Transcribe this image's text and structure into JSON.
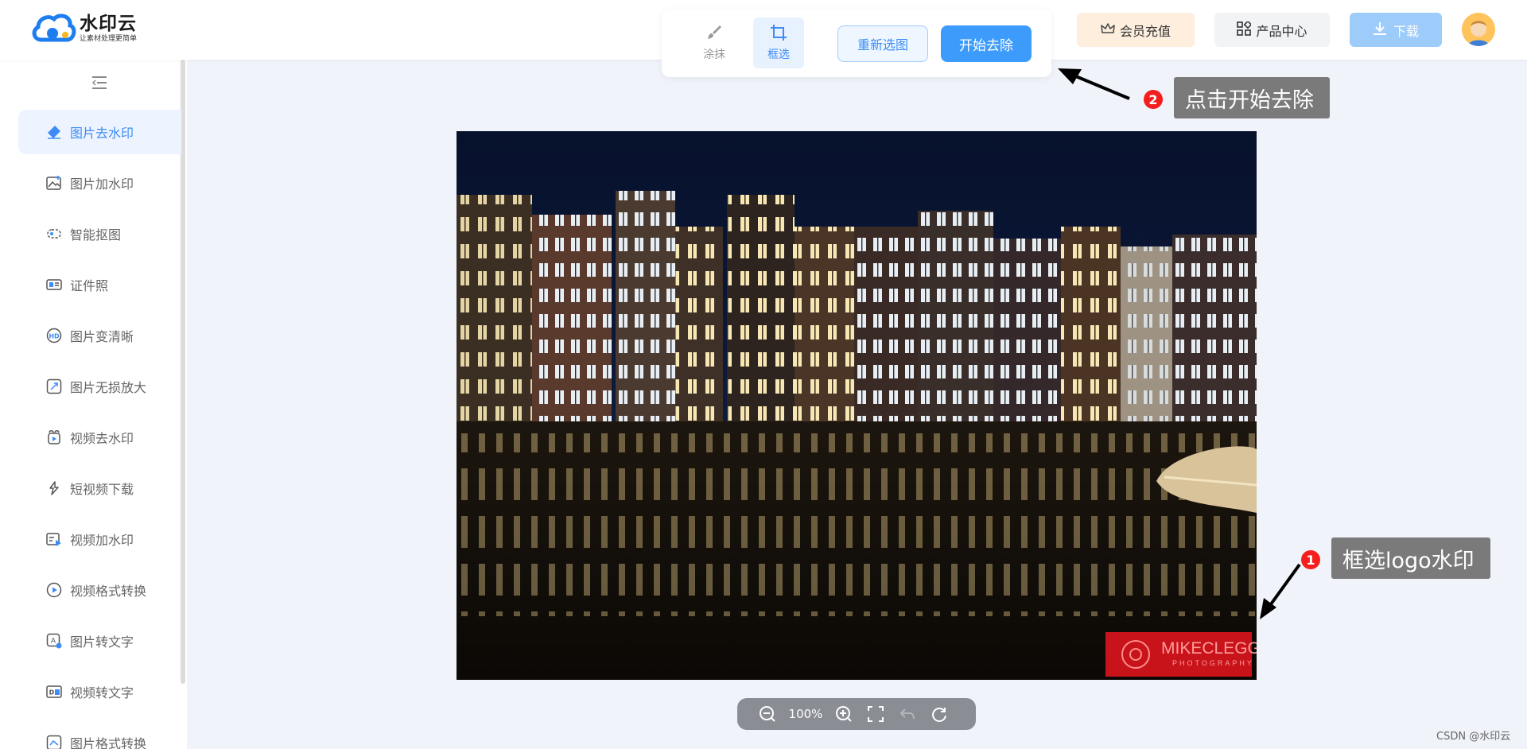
{
  "app": {
    "title": "水印云",
    "slogan": "让素材处理更简单"
  },
  "toolbar": {
    "tools": [
      {
        "label": "涂抹",
        "icon": "brush-icon",
        "active": false
      },
      {
        "label": "框选",
        "icon": "crop-icon",
        "active": true
      }
    ],
    "reselect_label": "重新选图",
    "start_label": "开始去除"
  },
  "header": {
    "vip_label": "会员充值",
    "products_label": "产品中心",
    "download_label": "下载"
  },
  "sidebar": {
    "items": [
      {
        "label": "图片去水印",
        "icon": "eraser-icon",
        "active": true
      },
      {
        "label": "图片加水印",
        "icon": "image-add-icon",
        "active": false
      },
      {
        "label": "智能抠图",
        "icon": "cutout-icon",
        "active": false
      },
      {
        "label": "证件照",
        "icon": "id-card-icon",
        "active": false
      },
      {
        "label": "图片变清晰",
        "icon": "hd-icon",
        "active": false
      },
      {
        "label": "图片无损放大",
        "icon": "enlarge-icon",
        "active": false
      },
      {
        "label": "视频去水印",
        "icon": "video-eraser-icon",
        "active": false
      },
      {
        "label": "短视频下载",
        "icon": "link-icon",
        "active": false
      },
      {
        "label": "视频加水印",
        "icon": "video-add-icon",
        "active": false
      },
      {
        "label": "视频格式转换",
        "icon": "play-circle-icon",
        "active": false
      },
      {
        "label": "图片转文字",
        "icon": "image-text-icon",
        "active": false
      },
      {
        "label": "视频转文字",
        "icon": "video-text-icon",
        "active": false
      },
      {
        "label": "图片格式转换",
        "icon": "image-format-icon",
        "active": false
      }
    ]
  },
  "canvas": {
    "watermark_line1": "MIKECLEGG",
    "watermark_line2": "PHOTOGRAPHY",
    "zoom": "100%"
  },
  "annotations": {
    "step1_badge": "1",
    "step1_text": "框选logo水印",
    "step2_badge": "2",
    "step2_text": "点击开始去除"
  },
  "footer": {
    "credit": "CSDN @水印云"
  },
  "colors": {
    "accent": "#3d9cfb",
    "badge_red": "#f41e1e",
    "watermark_red": "#c8131a"
  }
}
